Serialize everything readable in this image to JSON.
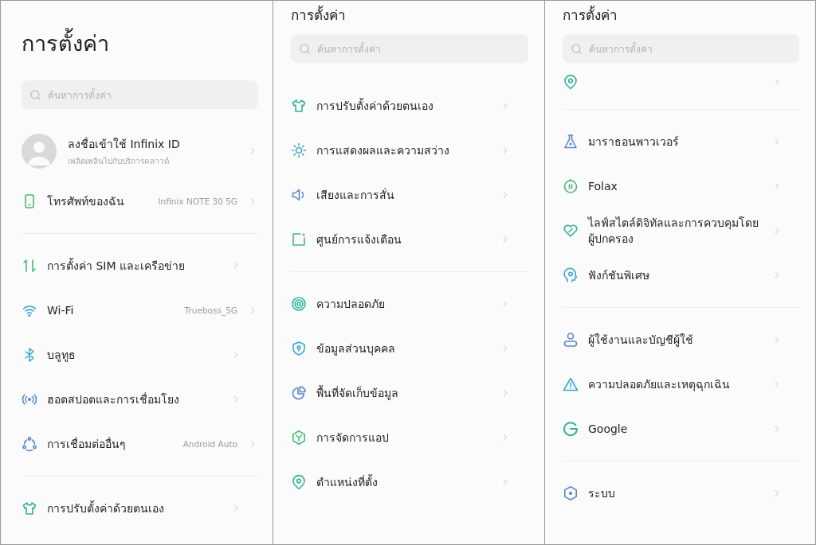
{
  "panels": [
    {
      "title": "การตั้งค่า",
      "search": {
        "placeholder": "ค้นหาการตั้งค่า"
      },
      "groups": [
        [
          {
            "kind": "account",
            "label": "ลงชื่อเข้าใช้ Infinix ID",
            "subtitle": "เพลิดเพลินไปกับบริการคลาวด์"
          },
          {
            "kind": "item",
            "label": "โทรศัพท์ของฉัน",
            "value": "Infinix NOTE 30 5G"
          }
        ],
        [
          {
            "kind": "item",
            "label": "การตั้งค่า SIM และเครือข่าย"
          },
          {
            "kind": "item",
            "label": "Wi-Fi",
            "value": "Trueboss_5G"
          },
          {
            "kind": "item",
            "label": "บลูทูธ"
          },
          {
            "kind": "item",
            "label": "ฮอตสปอตและการเชื่อมโยง"
          },
          {
            "kind": "item",
            "label": "การเชื่อมต่ออื่นๆ",
            "value": "Android Auto"
          }
        ],
        [
          {
            "kind": "item",
            "label": "การปรับตั้งค่าด้วยตนเอง"
          }
        ]
      ]
    },
    {
      "title": "การตั้งค่า",
      "search": {
        "placeholder": "ค้นหาการตั้งค่า"
      },
      "groups": [
        [
          {
            "kind": "item",
            "label": "การปรับตั้งค่าด้วยตนเอง"
          },
          {
            "kind": "item",
            "label": "การแสดงผลและความสว่าง"
          },
          {
            "kind": "item",
            "label": "เสียงและการสั่น"
          },
          {
            "kind": "item",
            "label": "ศูนย์การแจ้งเตือน"
          }
        ],
        [
          {
            "kind": "item",
            "label": "ความปลอดภัย"
          },
          {
            "kind": "item",
            "label": "ข้อมูลส่วนบุคคล"
          },
          {
            "kind": "item",
            "label": "พื้นที่จัดเก็บข้อมูล"
          },
          {
            "kind": "item",
            "label": "การจัดการแอป"
          },
          {
            "kind": "item",
            "label": "ตำแหน่งที่ตั้ง"
          }
        ]
      ]
    },
    {
      "title": "การตั้งค่า",
      "search": {
        "placeholder": "ค้นหาการตั้งค่า"
      },
      "groups": [
        [
          {
            "kind": "clipped"
          }
        ],
        [
          {
            "kind": "item",
            "label": "มาราธอนพาวเวอร์"
          },
          {
            "kind": "item",
            "label": "Folax"
          },
          {
            "kind": "item",
            "label": "ไลฟ์สไตล์ดิจิทัลและการควบคุมโดยผู้ปกครอง"
          },
          {
            "kind": "item",
            "label": "ฟังก์ชันพิเศษ"
          }
        ],
        [
          {
            "kind": "item",
            "label": "ผู้ใช้งานและบัญชีผู้ใช้"
          },
          {
            "kind": "item",
            "label": "ความปลอดภัยและเหตุฉุกเฉิน"
          },
          {
            "kind": "item",
            "label": "Google"
          }
        ],
        [
          {
            "kind": "item",
            "label": "ระบบ"
          }
        ]
      ]
    }
  ]
}
